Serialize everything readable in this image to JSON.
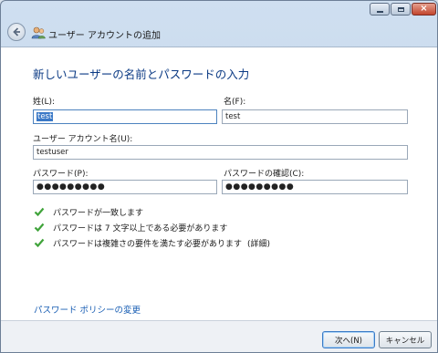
{
  "window": {
    "title": "ユーザー アカウントの追加",
    "controls": {
      "minimize": "minimize-icon",
      "maximize": "maximize-icon",
      "close": "close-icon"
    }
  },
  "page": {
    "heading": "新しいユーザーの名前とパスワードの入力"
  },
  "form": {
    "last_name": {
      "label": "姓(L):",
      "value": "test"
    },
    "first_name": {
      "label": "名(F):",
      "value": "test"
    },
    "account_name": {
      "label": "ユーザー アカウント名(U):",
      "value": "testuser"
    },
    "password": {
      "label": "パスワード(P):",
      "value": "●●●●●●●●●"
    },
    "confirm": {
      "label": "パスワードの確認(C):",
      "value": "●●●●●●●●●"
    }
  },
  "checks": [
    {
      "text": "パスワードが一致します"
    },
    {
      "text": "パスワードは 7 文字以上である必要があります"
    },
    {
      "text": "パスワードは複雑さの要件を満たす必要があります",
      "link": "(詳細)"
    }
  ],
  "policy_link": "パスワード ポリシーの変更",
  "buttons": {
    "next": "次へ(N)",
    "cancel": "キャンセル"
  },
  "colors": {
    "heading": "#0b3a84",
    "link": "#1a5fb4",
    "check": "#3fa33a",
    "selection": "#3b79c7"
  }
}
